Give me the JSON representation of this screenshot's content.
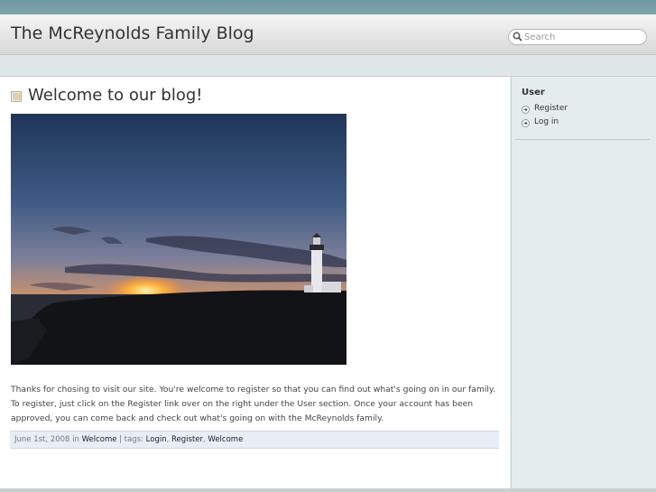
{
  "header": {
    "site_title": "The McReynolds Family Blog",
    "search_placeholder": "Search"
  },
  "post": {
    "title": "Welcome to our blog!",
    "image_alt": "Lighthouse at sunset",
    "body": "Thanks for chosing to visit our site. You're welcome to register so that you can find out what's going on in our family. To register, just click on the Register link over on the right under the User section. Once your account has been approved, you can come back and check out what's going on with the McReynolds family.",
    "meta": {
      "date": "June 1st, 2008",
      "in_label": "in",
      "category": "Welcome",
      "tags_label": "| tags:",
      "tags": [
        "Login",
        "Register",
        "Welcome"
      ]
    }
  },
  "sidebar": {
    "heading": "User",
    "items": [
      {
        "label": "Register"
      },
      {
        "label": "Log in"
      }
    ]
  },
  "colors": {
    "top_strip": "#7fa5ae",
    "sidebar_bg": "#e5ecee",
    "meta_bg": "#e8eef5"
  },
  "icons": [
    "search-icon",
    "post-icon",
    "arrow-bullet-icon"
  ]
}
